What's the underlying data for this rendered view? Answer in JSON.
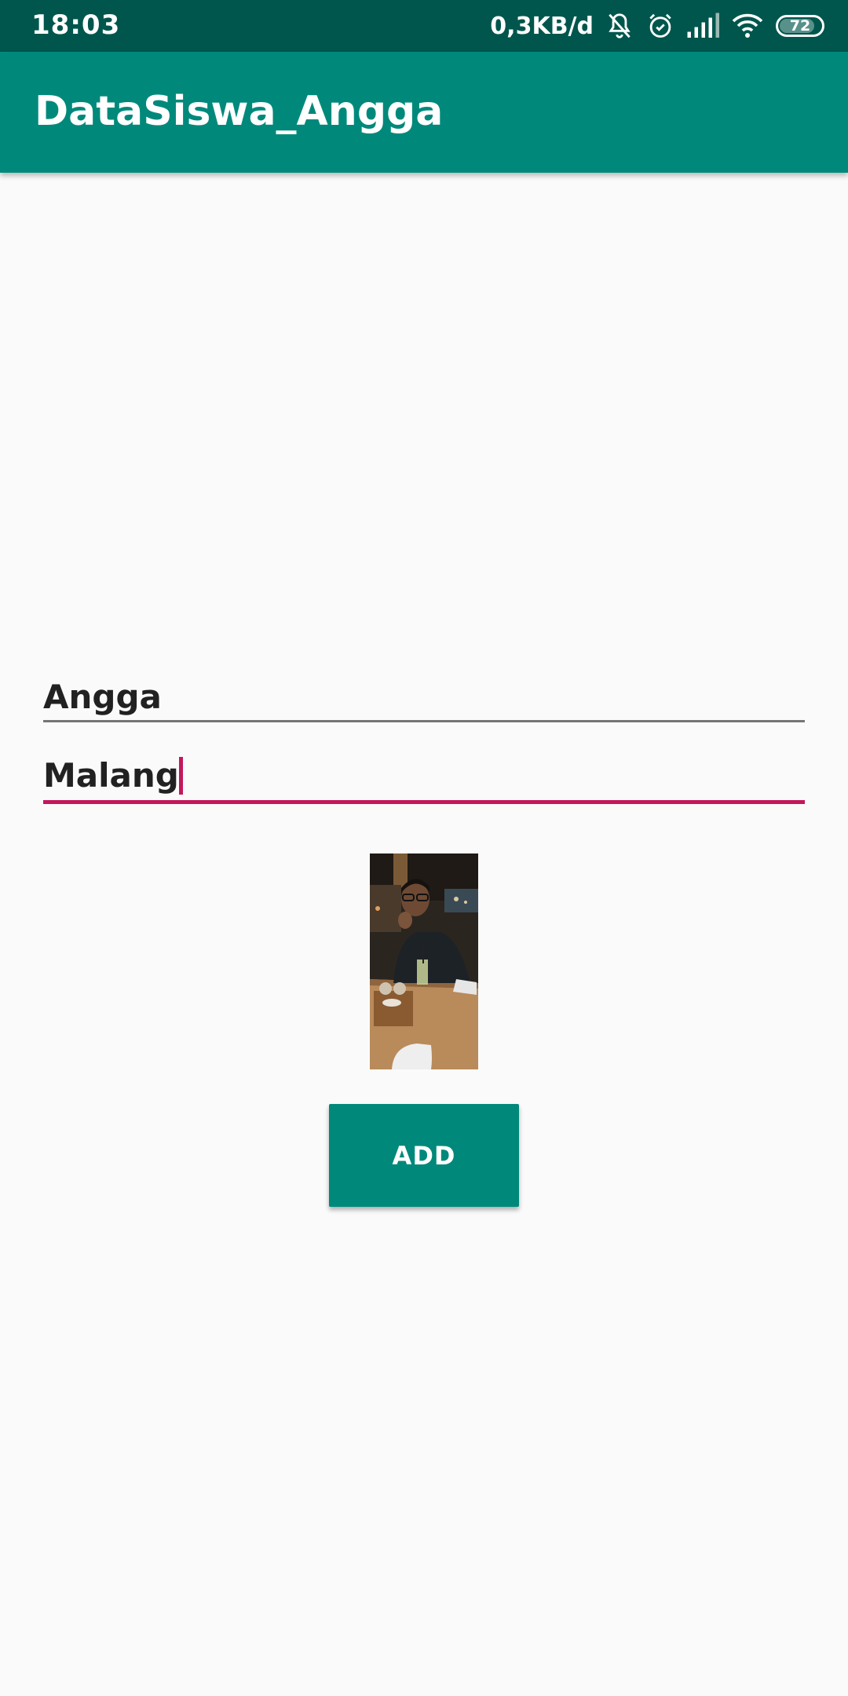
{
  "status_bar": {
    "time": "18:03",
    "net_speed": "0,3KB/d",
    "battery_level": "72",
    "icons": [
      "mute-bell-icon",
      "alarm-icon",
      "signal-icon",
      "wifi-icon",
      "battery-icon"
    ],
    "background_color": "#00564c"
  },
  "app_bar": {
    "title": "DataSiswa_Angga",
    "color": "#00897b"
  },
  "form": {
    "name_value": "Angga",
    "city_value": "Malang",
    "accent_color": "#c2185b"
  },
  "photo": {
    "subject": "person-photo"
  },
  "actions": {
    "add_label": "ADD"
  }
}
